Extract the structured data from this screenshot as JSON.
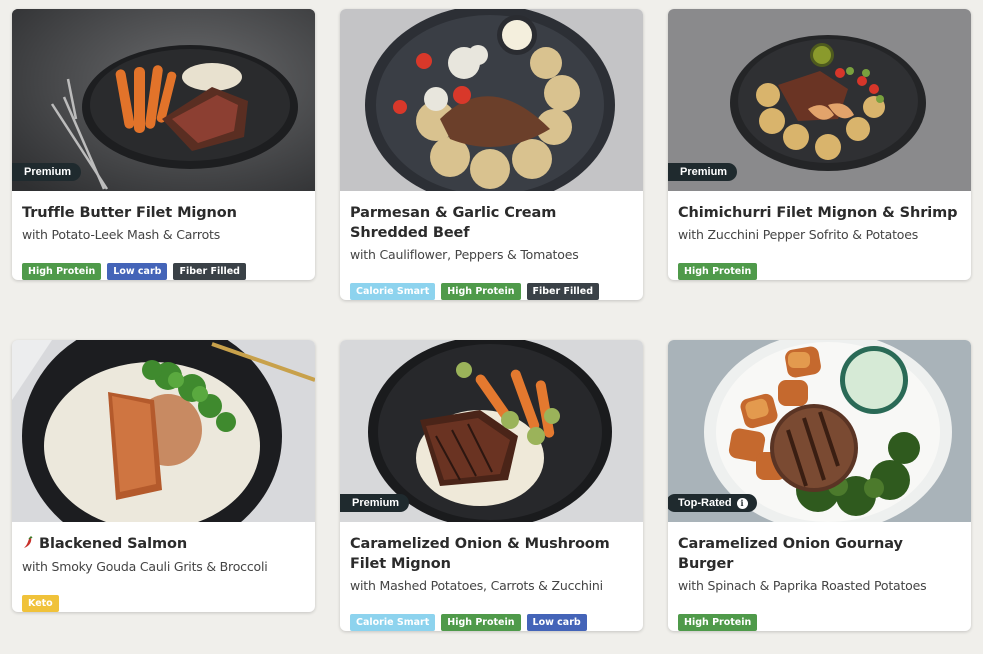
{
  "cards": [
    {
      "title": "Truffle Butter Filet Mignon",
      "subtitle": "with Potato-Leek Mash & Carrots",
      "image_badge": "Premium",
      "tags": [
        "High Protein",
        "Low carb",
        "Fiber Filled"
      ]
    },
    {
      "title": "Parmesan & Garlic Cream Shredded Beef",
      "subtitle": "with Cauliflower, Peppers & Tomatoes",
      "image_badge": "",
      "tags": [
        "Calorie Smart",
        "High Protein",
        "Fiber Filled"
      ]
    },
    {
      "title": "Chimichurri Filet Mignon & Shrimp",
      "subtitle": "with Zucchini Pepper Sofrito & Potatoes",
      "image_badge": "Premium",
      "tags": [
        "High Protein"
      ]
    },
    {
      "title": "Blackened Salmon",
      "subtitle": "with Smoky Gouda Cauli Grits & Broccoli",
      "image_badge": "",
      "spicy_icon": "chili-pepper-icon",
      "tags": [
        "Keto"
      ]
    },
    {
      "title": "Caramelized Onion & Mushroom Filet Mignon",
      "subtitle": "with Mashed Potatoes, Carrots & Zucchini",
      "image_badge": "Premium",
      "tags": [
        "Calorie Smart",
        "High Protein",
        "Low carb"
      ]
    },
    {
      "title": "Caramelized Onion Gournay Burger",
      "subtitle": "with Spinach & Paprika Roasted Potatoes",
      "image_badge": "Top-Rated",
      "image_badge_icon": "info-icon",
      "tags": [
        "High Protein"
      ]
    }
  ],
  "tag_colors": {
    "High Protein": "#4f9a4a",
    "Low carb": "#4464b8",
    "Fiber Filled": "#3a4147",
    "Calorie Smart": "#8dd3ee",
    "Keto": "#f0c23a"
  },
  "colors": {
    "page_bg": "#f0efeb",
    "badge_bg": "#1f2a2e"
  }
}
